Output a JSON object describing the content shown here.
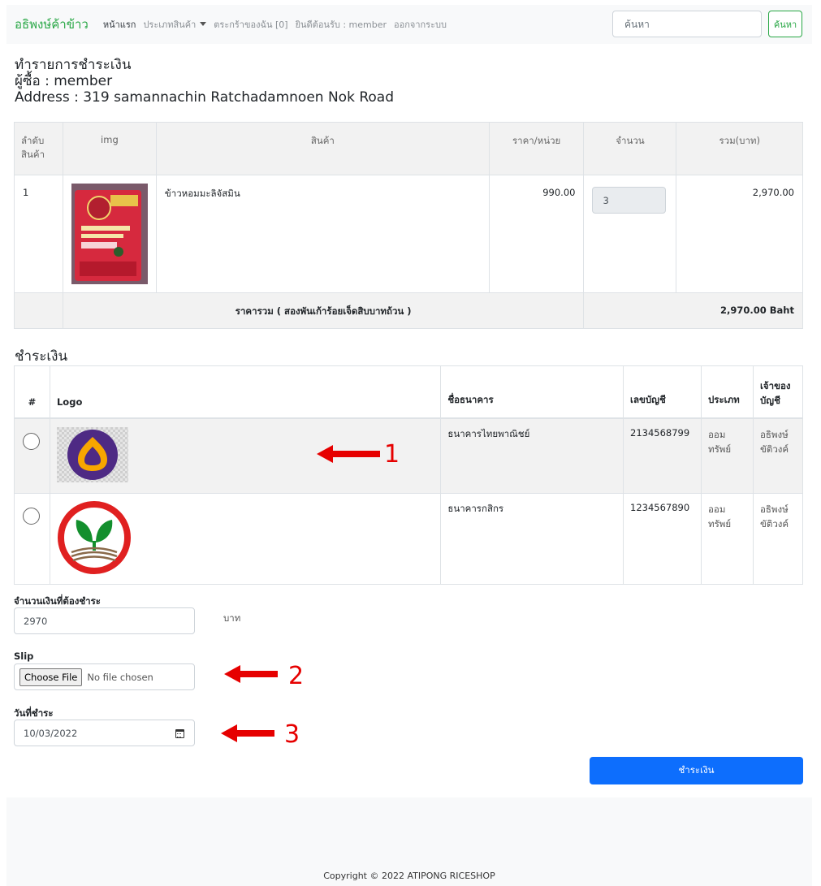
{
  "navbar": {
    "brand": "อธิพงษ์ค้าข้าว",
    "links": [
      "หน้าแรก",
      "ประเภทสินค้า",
      "ตระกร้าของฉัน [0]",
      "ยินดีต้อนรับ : member",
      "ออกจากระบบ"
    ],
    "search_placeholder": "ค้นหา",
    "search_button": "ค้นหา"
  },
  "header": {
    "title": "ทำรายการชำระเงิน",
    "buyer": "ผู้ซื้อ : member",
    "address": "Address : 319 samannachin Ratchadamnoen Nok Road"
  },
  "order": {
    "columns": [
      "ลำดับ\nสินค้า",
      "img",
      "สินค้า",
      "ราคา/หน่วย",
      "จำนวน",
      "รวม(บาท)"
    ],
    "rows": [
      {
        "no": "1",
        "name": "ข้าวหอมมะลิจัสมิน",
        "price": "990.00",
        "qty": "3",
        "total": "2,970.00"
      }
    ],
    "summary_label": "ราคารวม ( สองพันเก้าร้อยเจ็ดสิบบาทถ้วน )",
    "summary_total": "2,970.00 Baht"
  },
  "payment": {
    "title": "ชำระเงิน",
    "columns": [
      "#",
      "Logo",
      "ชื่อธนาคาร",
      "เลขบัญชี",
      "ประเภท",
      "เจ้าของบัญชี"
    ],
    "banks": [
      {
        "name": "ธนาคารไทยพาณิชย์",
        "account": "2134568799",
        "type": "ออมทรัพย์",
        "owner": "อธิพงษ์ ขัติวงค์",
        "color": "#4e2a84"
      },
      {
        "name": "ธนาคารกสิกร",
        "account": "1234567890",
        "type": "ออมทรัพย์",
        "owner": "อธิพงษ์ ขัติวงค์",
        "color": "#138f2d"
      }
    ]
  },
  "form": {
    "amount_label": "จำนวนเงินที่ต้องชำระ",
    "amount_value": "2970",
    "amount_unit": "บาท",
    "slip_label": "Slip",
    "choose_file": "Choose File",
    "no_file": "No file chosen",
    "date_label": "วันที่ชำระ",
    "date_value": "10/03/2022",
    "submit": "ชำระเงิน"
  },
  "annotations": [
    "1",
    "2",
    "3"
  ],
  "footer": {
    "copyright": "Copyright © 2022 ATIPONG RICESHOP"
  },
  "colors": {
    "brand": "#28a745",
    "primary": "#0d6efd",
    "arrow": "#e60000"
  }
}
